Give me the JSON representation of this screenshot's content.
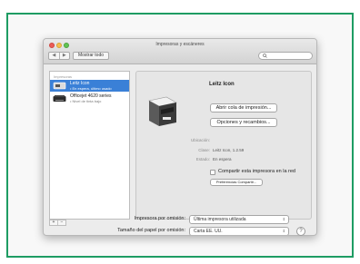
{
  "window": {
    "title": "Impresoras y escáneres"
  },
  "toolbar": {
    "back": "◀",
    "forward": "▶",
    "show_all": "Mostrar todo"
  },
  "printer_list": {
    "header": "Impresoras",
    "items": [
      {
        "name": "Leitz Icon",
        "status": "• En espera, último usado"
      },
      {
        "name": "Officejet 4620 series",
        "status": "• Nivel de tinta bajo"
      }
    ],
    "add": "+",
    "remove": "−"
  },
  "details": {
    "printer_name": "Leitz Icon",
    "open_queue_label": "Abrir cola de impresión...",
    "options_label": "Opciones y recambios...",
    "info": [
      {
        "label": "Ubicación:",
        "value": ""
      },
      {
        "label": "Clase:",
        "value": "Leitz Icon, 1.2.59"
      },
      {
        "label": "Estado:",
        "value": "En espera"
      }
    ],
    "share_label": "Compartir esta impresora en la red",
    "sharing_prefs_label": "Preferencias Compartir..."
  },
  "defaults": {
    "default_printer_label": "Impresora por omisión:",
    "default_printer_value": "Última impresora utilizada",
    "paper_size_label": "Tamaño del papel por omisión:",
    "paper_size_value": "Carta EE. UU."
  },
  "colors": {
    "selection": "#3a80d7",
    "frame": "#1e9c63"
  }
}
